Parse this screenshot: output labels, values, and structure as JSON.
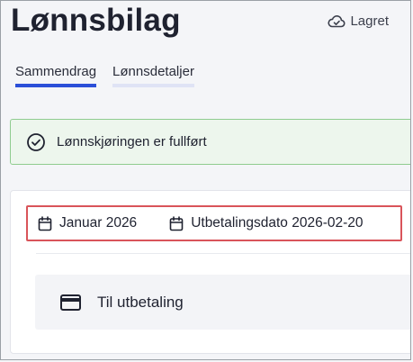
{
  "header": {
    "title": "Lønnsbilag",
    "saved_label": "Lagret",
    "saved_icon": "cloud-check-icon"
  },
  "tabs": [
    {
      "label": "Sammendrag",
      "active": true
    },
    {
      "label": "Lønnsdetaljer",
      "active": false
    }
  ],
  "alert": {
    "text": "Lønnskjøringen er fullført",
    "icon": "check-circle-icon",
    "color": "#8fcc8f"
  },
  "summary": {
    "period": {
      "label": "Januar 2026",
      "icon": "calendar-icon"
    },
    "payment_date": {
      "label": "Utbetalingsdato 2026-02-20",
      "icon": "calendar-icon"
    },
    "payout": {
      "label": "Til utbetaling",
      "icon": "credit-card-icon"
    }
  },
  "colors": {
    "accent": "#2b4fd8",
    "highlight_border": "#d9545a"
  }
}
